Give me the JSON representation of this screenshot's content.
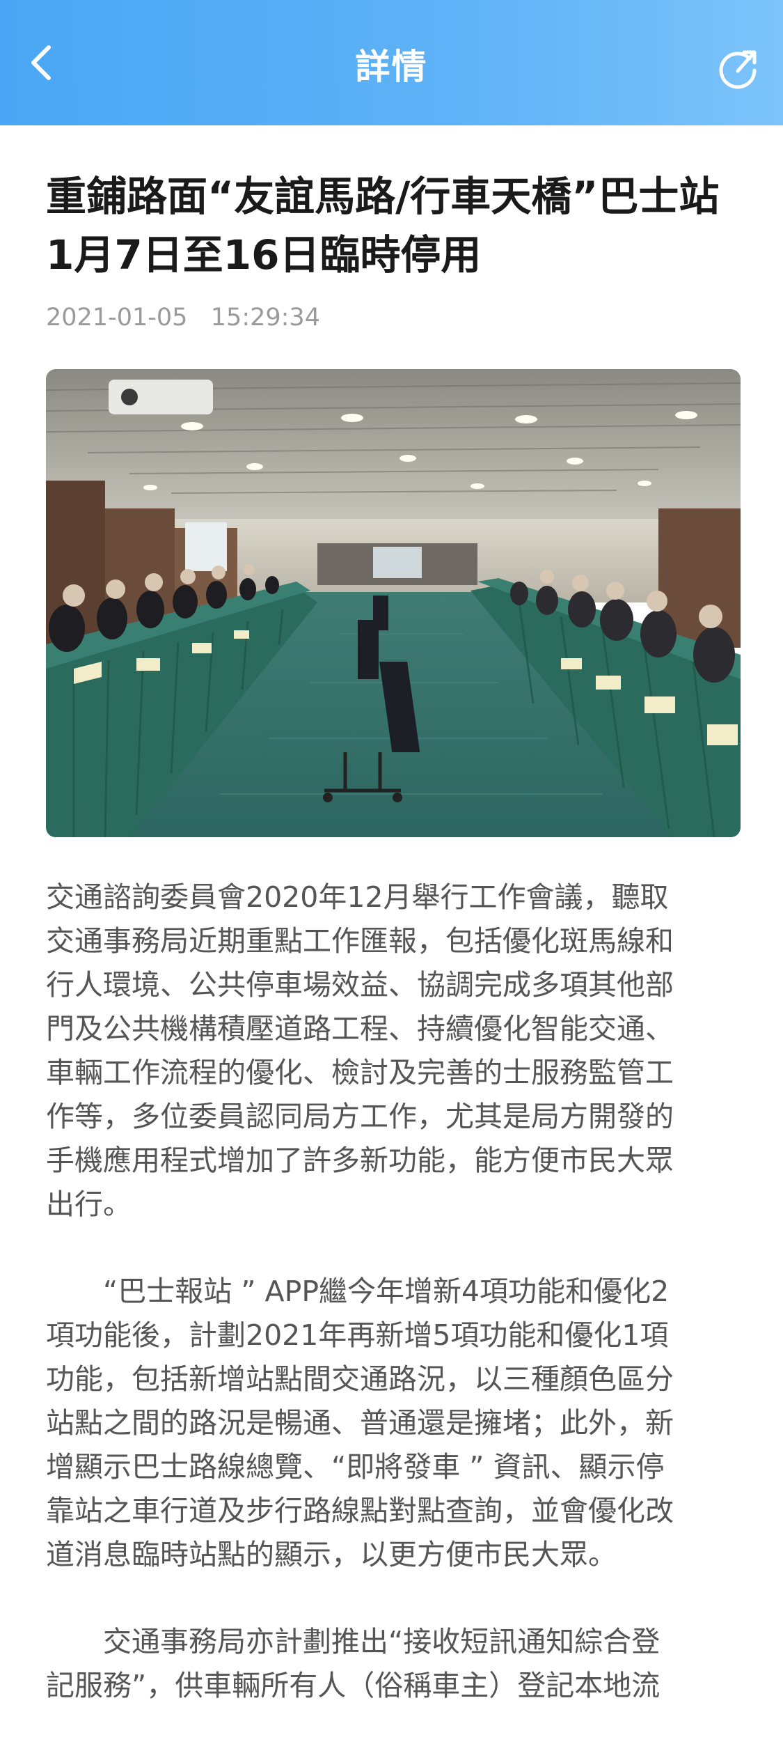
{
  "nav": {
    "title": "詳情",
    "back_icon": "chevron-left-icon",
    "share_icon": "share-icon",
    "gradient_start": "#4aa6f4",
    "gradient_end": "#7cc3fa"
  },
  "article": {
    "title": "重鋪路面“友誼馬路/行車天橋”巴士站\n1月7日至16日臨時停用",
    "meta": "2021-01-05   15:29:34",
    "image_alt": "交通諮詢委員會會議現場",
    "paragraphs": [
      "交通諮詢委員會2020年12月舉行工作會議，聽取\n交通事務局近期重點工作匯報，包括優化斑馬線和\n行人環境、公共停車場效益、協調完成多項其他部\n門及公共機構積壓道路工程、持續優化智能交通、\n車輛工作流程的優化、檢討及完善的士服務監管工\n作等，多位委員認同局方工作，尤其是局方開發的\n手機應用程式增加了許多新功能，能方便市民大眾\n出行。",
      "　　“巴士報站 ” APP繼今年增新4項功能和優化2\n項功能後，計劃2021年再新增5項功能和優化1項\n功能，包括新增站點間交通路況，以三種顏色區分\n站點之間的路況是暢通、普通還是擁堵；此外，新\n增顯示巴士路線總覽、“即將發車 ” 資訊、顯示停\n靠站之車行道及步行路線點對點查詢，並會優化改\n道消息臨時站點的顯示，以更方便市民大眾。",
      "　　交通事務局亦計劃推出“接收短訊通知綜合登\n記服務”，供車輛所有人（俗稱車主）登記本地流"
    ]
  }
}
